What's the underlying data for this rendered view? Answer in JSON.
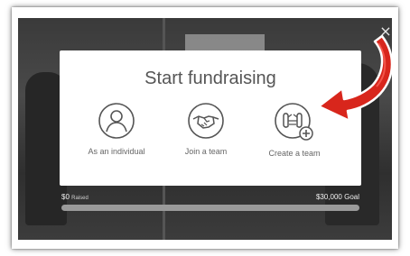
{
  "modal": {
    "title": "Start fundraising",
    "options": [
      {
        "label": "As an individual",
        "icon": "person-icon"
      },
      {
        "label": "Join a team",
        "icon": "handshake-icon"
      },
      {
        "label": "Create a team",
        "icon": "create-team-icon"
      }
    ]
  },
  "close": {
    "glyph": "×"
  },
  "progress": {
    "raised_amount": "$0",
    "raised_label": "Raised",
    "goal_text": "$30,000 Goal",
    "fraction": 0
  },
  "colors": {
    "icon_stroke": "#555555",
    "arrow_red": "#d8261c",
    "backdrop": "#3a3a3a"
  }
}
